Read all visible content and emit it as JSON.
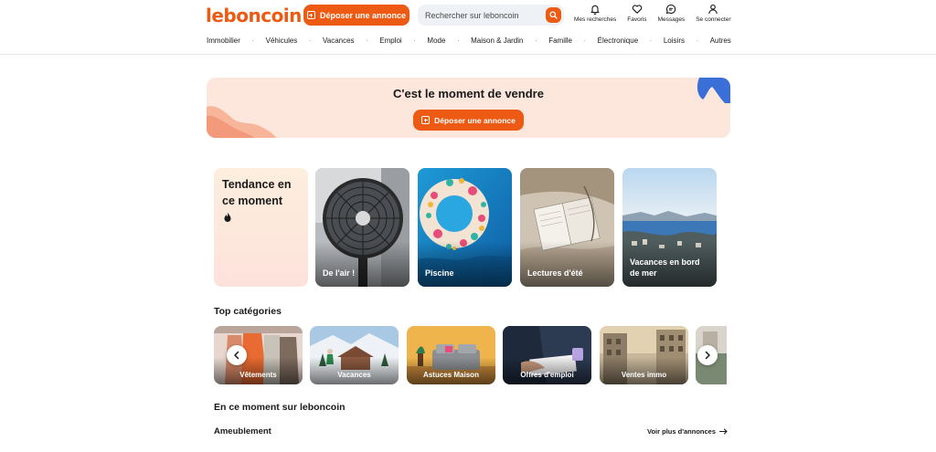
{
  "header": {
    "logo": "leboncoin",
    "post_button": "Déposer une annonce",
    "search_placeholder": "Rechercher sur leboncoin",
    "icons": [
      {
        "label": "Mes recherches",
        "icon": "bell-icon"
      },
      {
        "label": "Favoris",
        "icon": "heart-icon"
      },
      {
        "label": "Messages",
        "icon": "message-icon"
      },
      {
        "label": "Se connecter",
        "icon": "user-icon"
      }
    ]
  },
  "nav": {
    "items": [
      "Immobilier",
      "Véhicules",
      "Vacances",
      "Emploi",
      "Mode",
      "Maison & Jardin",
      "Famille",
      "Électronique",
      "Loisirs",
      "Autres"
    ],
    "separator": "·"
  },
  "banner": {
    "title": "C'est le moment de vendre",
    "button": "Déposer une annonce"
  },
  "trending": {
    "title": "Tendance en ce moment",
    "cards": [
      {
        "label": "De l'air !"
      },
      {
        "label": "Piscine"
      },
      {
        "label": "Lectures d'été"
      },
      {
        "label": "Vacances en bord de mer"
      }
    ]
  },
  "top_categories": {
    "title": "Top catégories",
    "items": [
      "Vêtements",
      "Vacances",
      "Astuces Maison",
      "Offres d'emploi",
      "Ventes immo"
    ]
  },
  "moment": {
    "title": "En ce moment sur leboncoin",
    "subsection": "Ameublement",
    "see_more": "Voir plus d'annonces"
  },
  "colors": {
    "brand": "#ec5a13",
    "banner_bg": "#fde6dc"
  }
}
